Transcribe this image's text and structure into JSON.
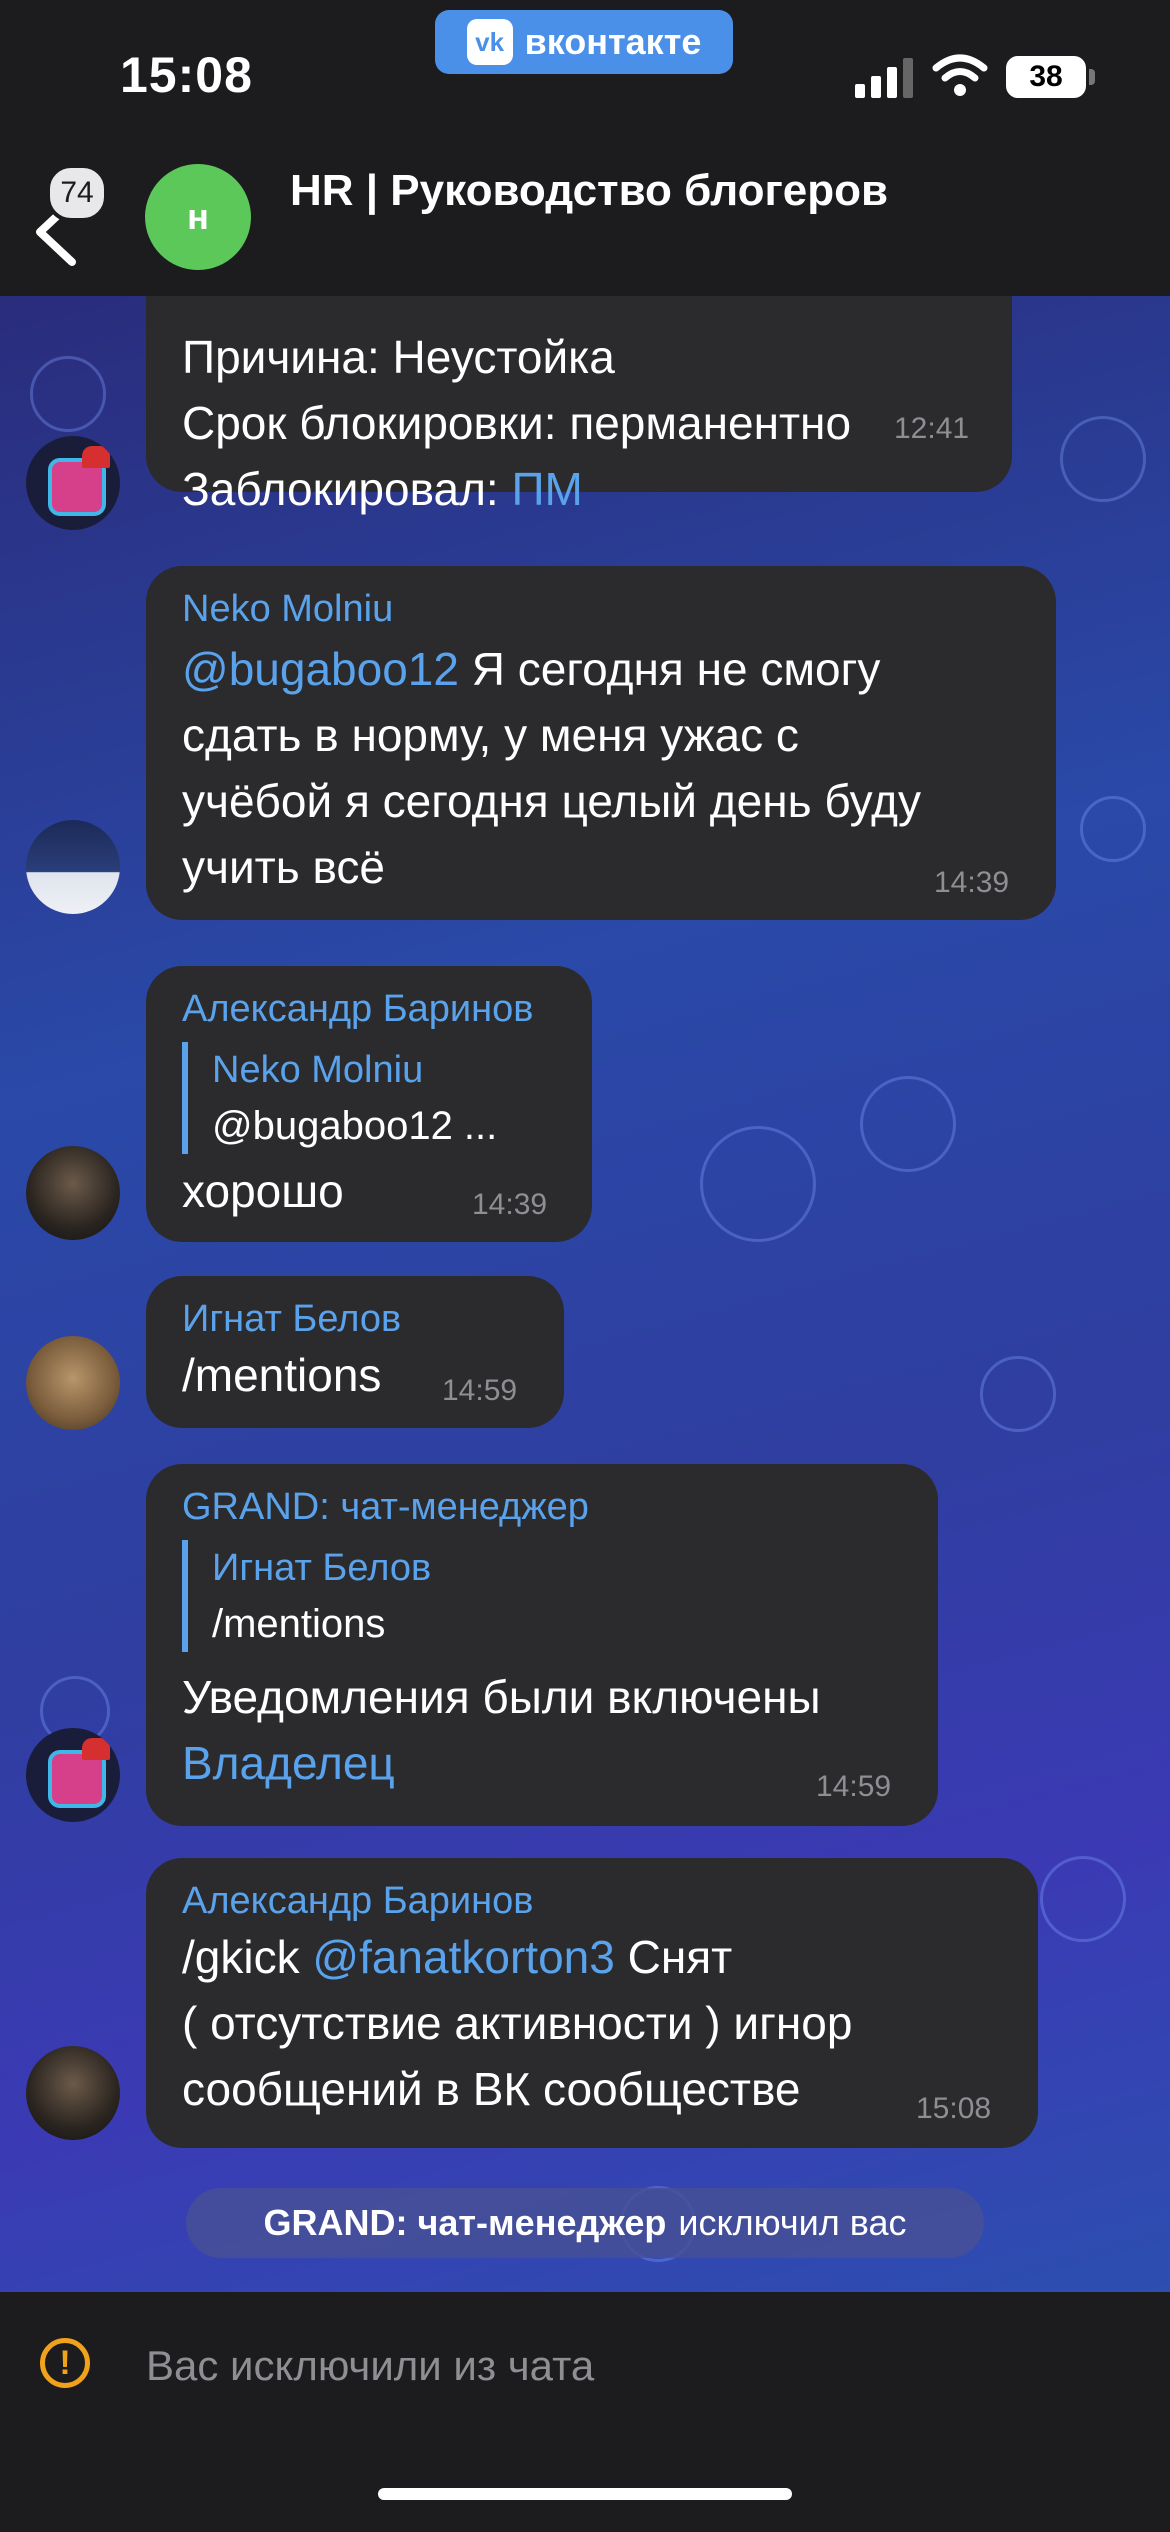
{
  "status_bar": {
    "time": "15:08",
    "app_pill_logo": "vk",
    "app_pill_label": "вконтакте",
    "battery": "38"
  },
  "header": {
    "unread_count": "74",
    "avatar_letter": "н",
    "title": "HR | Руководство блогеров"
  },
  "messages": [
    {
      "lines": [
        "Причина: Неустойка",
        "Срок блокировки: перманентно",
        "Заблокировал: "
      ],
      "mention": "ПМ",
      "time": "12:41"
    },
    {
      "sender": "Neko Molniu",
      "mention": "@bugaboo12",
      "line1": " Я сегодня не смогу",
      "line2": "сдать в норму, у меня ужас с",
      "line3": "учёбой я сегодня целый день буду",
      "line4": "учить всё",
      "time": "14:39"
    },
    {
      "sender": "Александр Баринов",
      "reply_name": "Neko Molniu",
      "reply_text": "@bugaboo12 ...",
      "text": "хорошо",
      "time": "14:39"
    },
    {
      "sender": "Игнат Белов",
      "text": "/mentions",
      "time": "14:59"
    },
    {
      "sender": "GRAND: чат-менеджер",
      "reply_name": "Игнат Белов",
      "reply_text": "/mentions",
      "text": "Уведомления были включены",
      "mention": "Владелец",
      "time": "14:59"
    },
    {
      "sender": "Александр Баринов",
      "prefix": "/gkick ",
      "mention": "@fanatkorton3",
      "line1_rest": " Снят",
      "line2": "( отсутствие активности ) игнор",
      "line3": "сообщений в ВК сообществе",
      "time": "15:08"
    }
  ],
  "service_message": {
    "actor": "GRAND: чат-менеджер",
    "action": "исключил вас"
  },
  "bottom": {
    "warning_icon": "exclamation-circle-icon",
    "text": "Вас исключили из чата"
  },
  "colors": {
    "accent": "#5aa3ec",
    "bubble": "#2b2b2e",
    "warning": "#f0a21a",
    "avatar_green": "#5cc85a"
  }
}
